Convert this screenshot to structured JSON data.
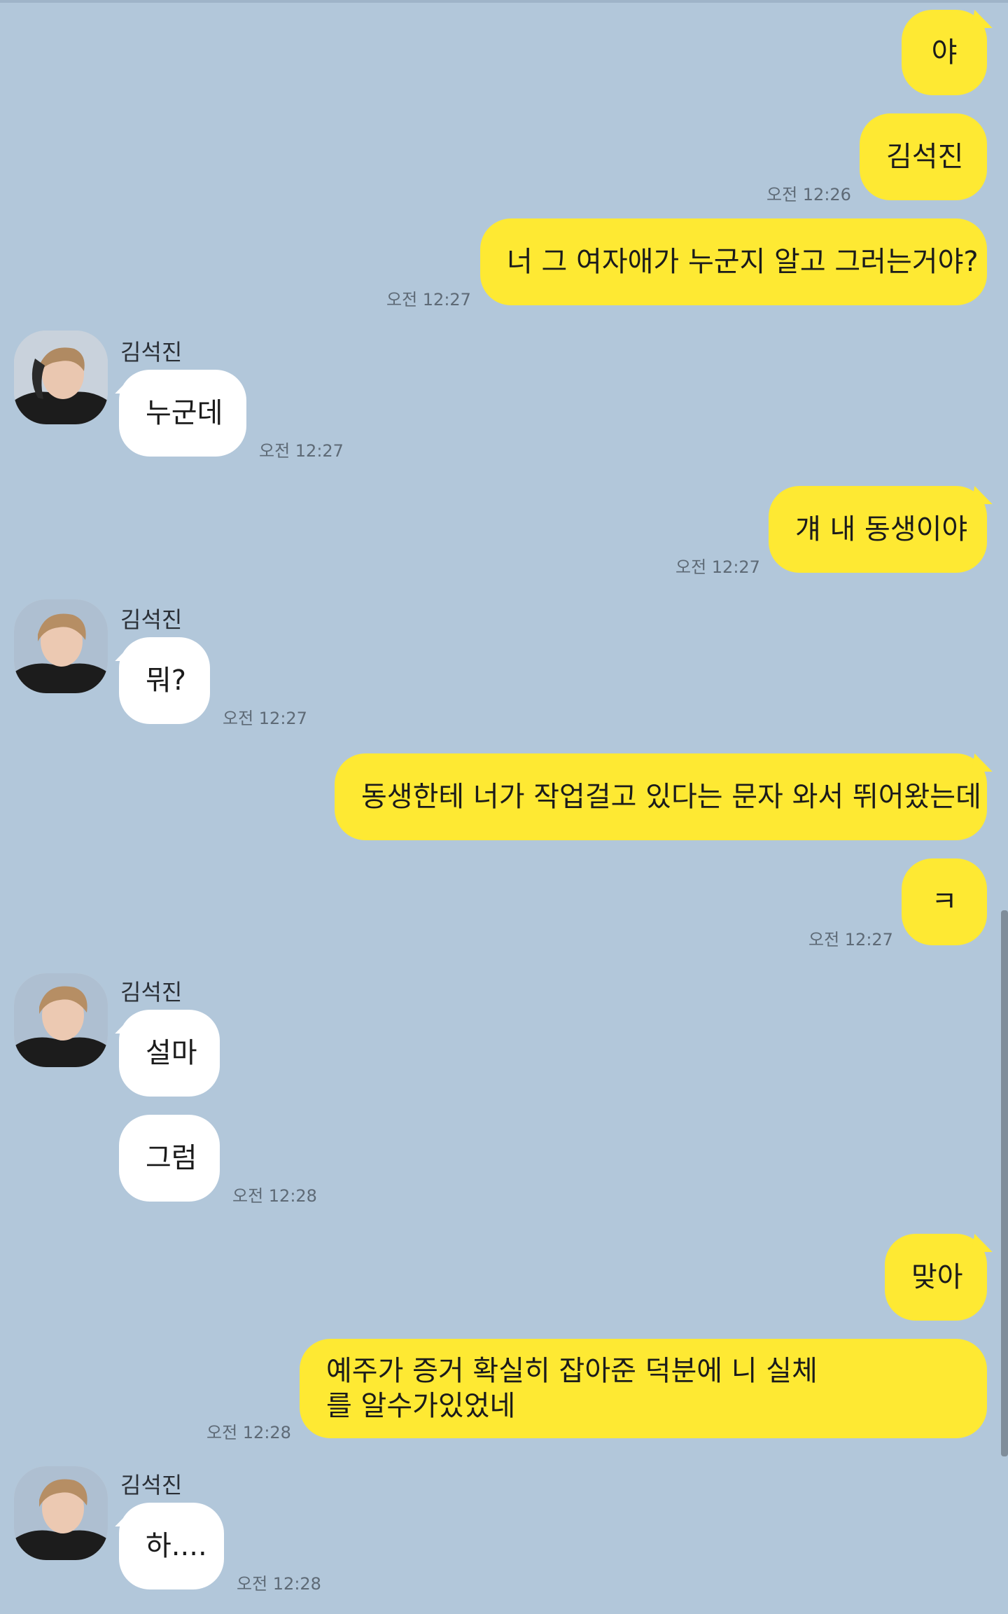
{
  "contact": {
    "name": "김석진"
  },
  "messages": [
    {
      "sender": "me",
      "text": "야"
    },
    {
      "sender": "me",
      "text": "김석진",
      "time": "오전 12:26"
    },
    {
      "sender": "me",
      "text": "너 그 여자애가 누군지 알고 그러는거야?",
      "time": "오전 12:27"
    },
    {
      "sender": "them",
      "text": "누군데",
      "time": "오전 12:27"
    },
    {
      "sender": "me",
      "text": "걔 내 동생이야",
      "time": "오전 12:27"
    },
    {
      "sender": "them",
      "text": "뭐?",
      "time": "오전 12:27"
    },
    {
      "sender": "me",
      "text": "동생한테 너가 작업걸고 있다는 문자 와서 뛰어왔는데"
    },
    {
      "sender": "me",
      "text": "ㅋ",
      "time": "오전 12:27"
    },
    {
      "sender": "them",
      "text": "설마"
    },
    {
      "sender": "them",
      "text": "그럼",
      "time": "오전 12:28"
    },
    {
      "sender": "me",
      "text": "맞아"
    },
    {
      "sender": "me",
      "text": "예주가 증거 확실히 잡아준 덕분에 니 실체를 알수가있었네",
      "time": "오전 12:28"
    },
    {
      "sender": "them",
      "text": "하....",
      "time": "오전 12:28"
    }
  ],
  "colors": {
    "background": "#b2c7da",
    "my_bubble": "#fee933",
    "their_bubble": "#ffffff"
  },
  "icons": {
    "avatar": "profile-photo-avatar"
  }
}
